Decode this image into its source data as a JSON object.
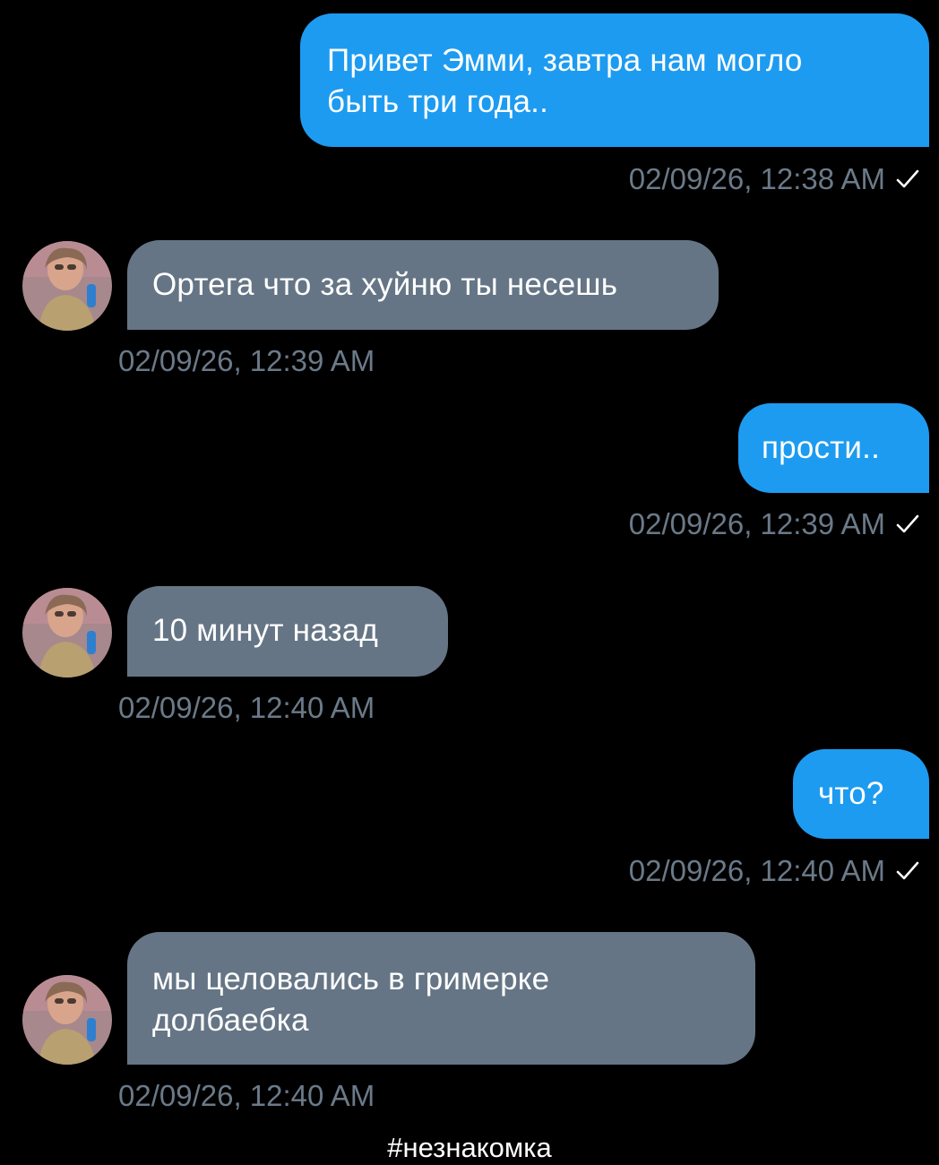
{
  "messages": [
    {
      "direction": "out",
      "text": "Привет Эмми, завтра нам могло\nбыть три года..",
      "timestamp": "02/09/26, 12:38 AM",
      "read_icon": "check-icon"
    },
    {
      "direction": "in",
      "text": "Ортега что за хуйню ты несешь",
      "timestamp": "02/09/26, 12:39 AM",
      "avatar_icon": "contact-avatar"
    },
    {
      "direction": "out",
      "text": "прости..",
      "timestamp": "02/09/26, 12:39 AM",
      "read_icon": "check-icon"
    },
    {
      "direction": "in",
      "text": "10 минут назад",
      "timestamp": "02/09/26, 12:40 AM",
      "avatar_icon": "contact-avatar"
    },
    {
      "direction": "out",
      "text": "что?",
      "timestamp": "02/09/26, 12:40 AM",
      "read_icon": "check-icon"
    },
    {
      "direction": "in",
      "text": "мы целовались в гримерке\nдолбаебка",
      "timestamp": "02/09/26, 12:40 AM",
      "avatar_icon": "contact-avatar"
    }
  ],
  "footer": {
    "hashtag": "#незнакомка"
  },
  "colors": {
    "outgoing_bubble": "#1d9bf0",
    "incoming_bubble": "#657585",
    "timestamp": "#6b7a89",
    "background": "#000000"
  }
}
